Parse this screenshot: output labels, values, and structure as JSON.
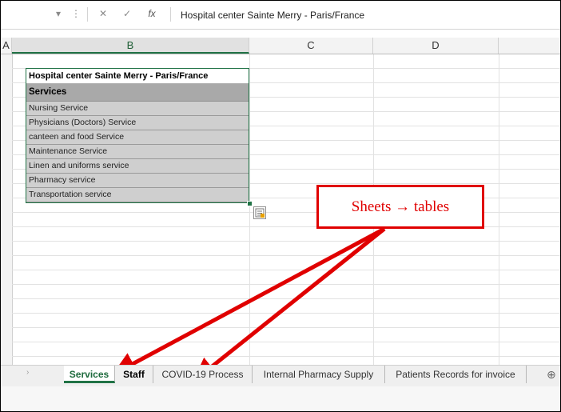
{
  "formula_bar": {
    "name_box_arrow": "▾",
    "more_label": "⋮",
    "cancel_label": "✕",
    "enter_label": "✓",
    "fx_label": "fx",
    "content": "Hospital center Sainte Merry - Paris/France"
  },
  "columns": [
    "A",
    "B",
    "C",
    "D"
  ],
  "table": {
    "title": "Hospital center Sainte Merry - Paris/France",
    "header": "Services",
    "rows": [
      "Nursing Service",
      "Physicians (Doctors) Service",
      "canteen and food Service",
      "Maintenance Service",
      "Linen and uniforms service",
      "Pharmacy service",
      "Transportation service"
    ]
  },
  "callout": {
    "text": "Sheets → tables",
    "color": "#e00000"
  },
  "tabs": {
    "scroll_label": "›",
    "items": [
      "Services",
      "Staff",
      "COVID-19 Process",
      "Internal Pharmacy Supply",
      "Patients Records for invoice"
    ],
    "active": "Services",
    "add_label": "⊕"
  },
  "colors": {
    "accent": "#217346",
    "annotation": "#e00000"
  }
}
